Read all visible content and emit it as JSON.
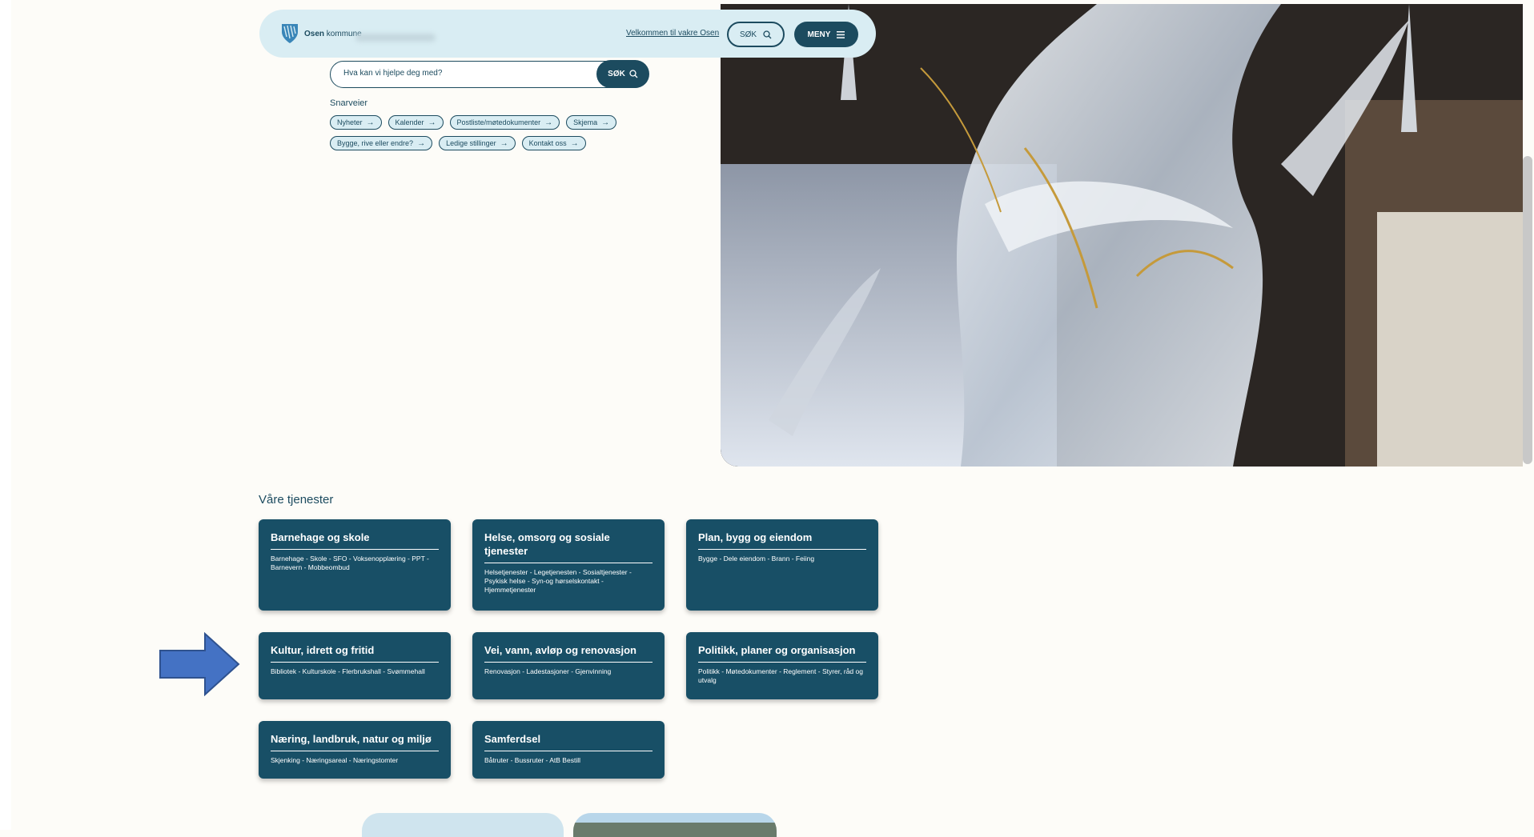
{
  "header": {
    "logo_name": "Osen",
    "logo_suffix": "kommune",
    "welcome_link": "Velkommen til vakre Osen",
    "search_label": "SØK",
    "menu_label": "MENY",
    "icons": [
      "logo-shield-icon",
      "search-icon",
      "hamburger-icon"
    ]
  },
  "search": {
    "placeholder": "Hva kan vi hjelpe deg med?",
    "button_label": "SØK"
  },
  "shortcuts": {
    "title": "Snarveier",
    "items": [
      "Nyheter",
      "Kalender",
      "Postliste/møtedokumenter",
      "Skjema",
      "Bygge, rive eller endre?",
      "Ledige stillinger",
      "Kontakt oss"
    ]
  },
  "services": {
    "title": "Våre tjenester",
    "cards": [
      {
        "title": "Barnehage og skole",
        "links": "Barnehage - Skole - SFO - Voksenopplæring - PPT - Barnevern - Mobbeombud"
      },
      {
        "title": "Helse, omsorg og sosiale tjenester",
        "links": "Helsetjenester - Legetjenesten - Sosialtjenester - Psykisk helse - Syn-og hørselskontakt - Hjemmetjenester"
      },
      {
        "title": "Plan, bygg og eiendom",
        "links": "Bygge - Dele eiendom - Brann - Feiing"
      },
      {
        "title": "Kultur, idrett og fritid",
        "links": "Bibliotek - Kulturskole - Flerbrukshall - Svømmehall"
      },
      {
        "title": "Vei, vann, avløp og renovasjon",
        "links": "Renovasjon - Ladestasjoner - Gjenvinning"
      },
      {
        "title": "Politikk, planer og organisasjon",
        "links": "Politikk - Møtedokumenter - Reglement - Styrer, råd og utvalg"
      },
      {
        "title": "Næring, landbruk, natur og miljø",
        "links": "Skjenking - Næringsareal - Næringstomter"
      },
      {
        "title": "Samferdsel",
        "links": "Båtruter - Bussruter - AtB Bestill"
      }
    ]
  },
  "colors": {
    "primary": "#1c4b5f",
    "card": "#184f66",
    "header_bg": "#d9edf3",
    "arrow": "#4472c4",
    "page_bg": "#fdfcf8"
  }
}
